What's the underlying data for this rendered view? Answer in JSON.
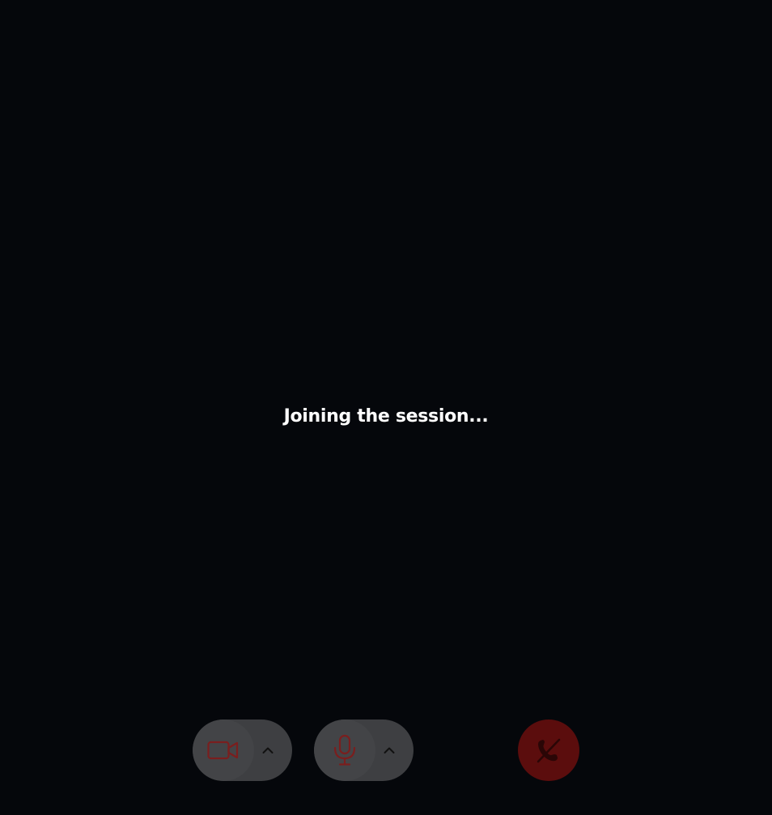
{
  "session": {
    "status_text": "Joining the session..."
  },
  "controls": {
    "camera": {
      "icon": "video-camera-icon",
      "state": "off",
      "options_icon": "chevron-up-icon"
    },
    "microphone": {
      "icon": "microphone-icon",
      "state": "off",
      "options_icon": "chevron-up-icon"
    },
    "end_call": {
      "icon": "phone-hangup-icon"
    }
  },
  "colors": {
    "background": "#05070b",
    "control_bg": "#3e3f42",
    "muted_icon": "#7a1e1e",
    "caret": "#111111",
    "end_call_bg": "#5b0d0d",
    "end_call_icon": "#2a0606"
  }
}
